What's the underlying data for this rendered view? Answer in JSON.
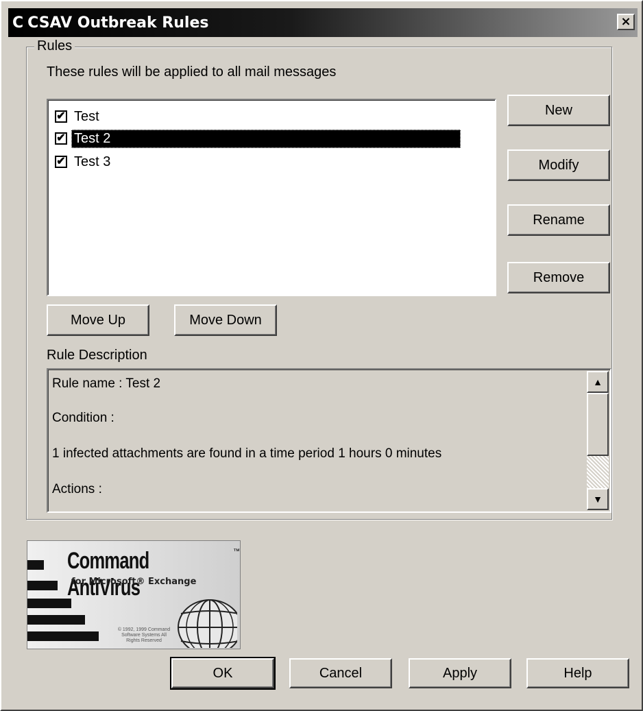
{
  "window": {
    "title": "CSAV Outbreak Rules",
    "app_icon": "C",
    "close_label": "×"
  },
  "rules_group": {
    "legend": "Rules",
    "intro_label": "These rules will be applied to all mail messages",
    "rules": [
      {
        "label": "Test",
        "checked": true,
        "selected": false
      },
      {
        "label": "Test 2",
        "checked": true,
        "selected": true
      },
      {
        "label": "Test 3",
        "checked": true,
        "selected": false
      }
    ],
    "buttons": {
      "new": "New",
      "modify": "Modify",
      "rename": "Rename",
      "remove": "Remove",
      "move_up": "Move Up",
      "move_down": "Move Down"
    },
    "description_label": "Rule Description",
    "description": {
      "rule_name": "Rule name :  Test 2",
      "condition_label": "Condition :",
      "condition_text": "1  infected attachments are found in a time period 1 hours 0 minutes",
      "actions_label": "Actions :"
    }
  },
  "logo": {
    "brand": "Command AntiVirus",
    "trademark": "™",
    "subtitle": "for Microsoft® Exchange",
    "copyright": "© 1992, 1999 Command Software Systems All Rights Reserved"
  },
  "footer_buttons": {
    "ok": "OK",
    "cancel": "Cancel",
    "apply": "Apply",
    "help": "Help"
  },
  "icons": {
    "check": "✔",
    "scroll_up": "▲",
    "scroll_down": "▼"
  }
}
